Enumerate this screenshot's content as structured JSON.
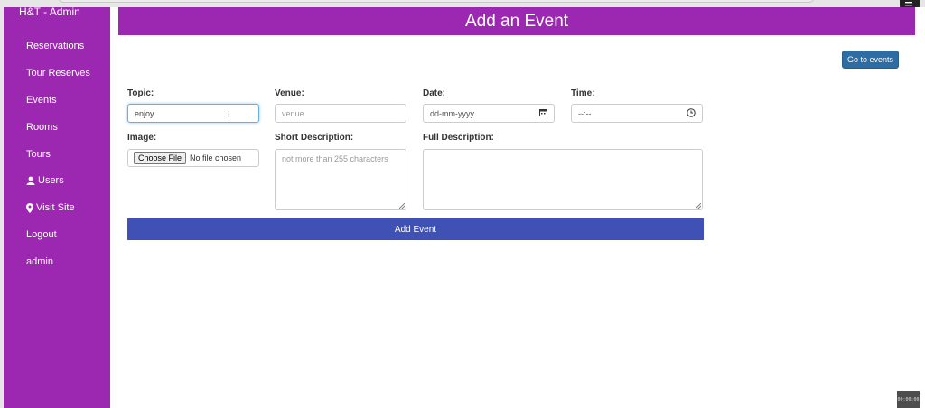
{
  "sidebar": {
    "brand": "H&T - Admin",
    "items": [
      {
        "label": "Reservations",
        "icon": ""
      },
      {
        "label": "Tour Reserves",
        "icon": ""
      },
      {
        "label": "Events",
        "icon": ""
      },
      {
        "label": "Rooms",
        "icon": ""
      },
      {
        "label": "Tours",
        "icon": ""
      },
      {
        "label": "Users",
        "icon": "user-icon"
      },
      {
        "label": "Visit Site",
        "icon": "map-marker-icon"
      },
      {
        "label": "Logout",
        "icon": ""
      },
      {
        "label": "admin",
        "icon": ""
      }
    ]
  },
  "header": {
    "title": "Add an Event",
    "go_to_events_label": "Go to events"
  },
  "form": {
    "topic": {
      "label": "Topic:",
      "value": "enjoy"
    },
    "venue": {
      "label": "Venue:",
      "placeholder": "venue"
    },
    "date": {
      "label": "Date:",
      "value": "dd-mm-yyyy",
      "icon": "calendar-icon"
    },
    "time": {
      "label": "Time:",
      "value": "--:--",
      "icon": "clock-icon"
    },
    "image": {
      "label": "Image:",
      "button_label": "Choose File",
      "status": "No file chosen"
    },
    "short_description": {
      "label": "Short Description:",
      "placeholder": "not more than 255 characters"
    },
    "full_description": {
      "label": "Full Description:",
      "placeholder": ""
    },
    "submit_label": "Add Event"
  },
  "colors": {
    "sidebar": "#9c27b0",
    "header": "#9c27b0",
    "primary_button": "#2e6da4",
    "submit_button": "#3f51b5"
  },
  "widgets": {
    "corner_widget_text": "00:00:00"
  }
}
